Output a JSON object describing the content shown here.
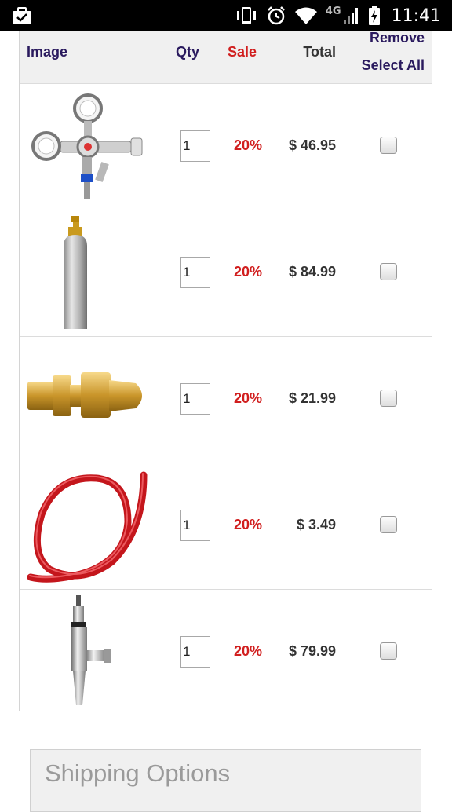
{
  "status_bar": {
    "network": "4G",
    "time": "11:41",
    "icons": [
      "briefcase-check-icon",
      "vibrate-icon",
      "alarm-icon",
      "wifi-icon",
      "signal-icon",
      "battery-charging-icon"
    ]
  },
  "cart": {
    "headers": {
      "image": "Image",
      "qty": "Qty",
      "sale": "Sale",
      "total": "Total",
      "remove": "Remove",
      "select_all": "Select All"
    },
    "items": [
      {
        "name": "co2-regulator",
        "qty": "1",
        "sale": "20%",
        "total": "$ 46.95",
        "checked": false
      },
      {
        "name": "co2-tank",
        "qty": "1",
        "sale": "20%",
        "total": "$ 84.99",
        "checked": false
      },
      {
        "name": "brass-adapter",
        "qty": "1",
        "sale": "20%",
        "total": "$ 21.99",
        "checked": false
      },
      {
        "name": "red-gas-hose",
        "qty": "1",
        "sale": "20%",
        "total": "$ 3.49",
        "checked": false
      },
      {
        "name": "stout-faucet",
        "qty": "1",
        "sale": "20%",
        "total": "$ 79.99",
        "checked": false
      }
    ]
  },
  "shipping": {
    "title": "Shipping Options"
  },
  "colors": {
    "header_text": "#2a1a5e",
    "sale_red": "#d11f1f",
    "header_bg": "#f0f0f0"
  }
}
